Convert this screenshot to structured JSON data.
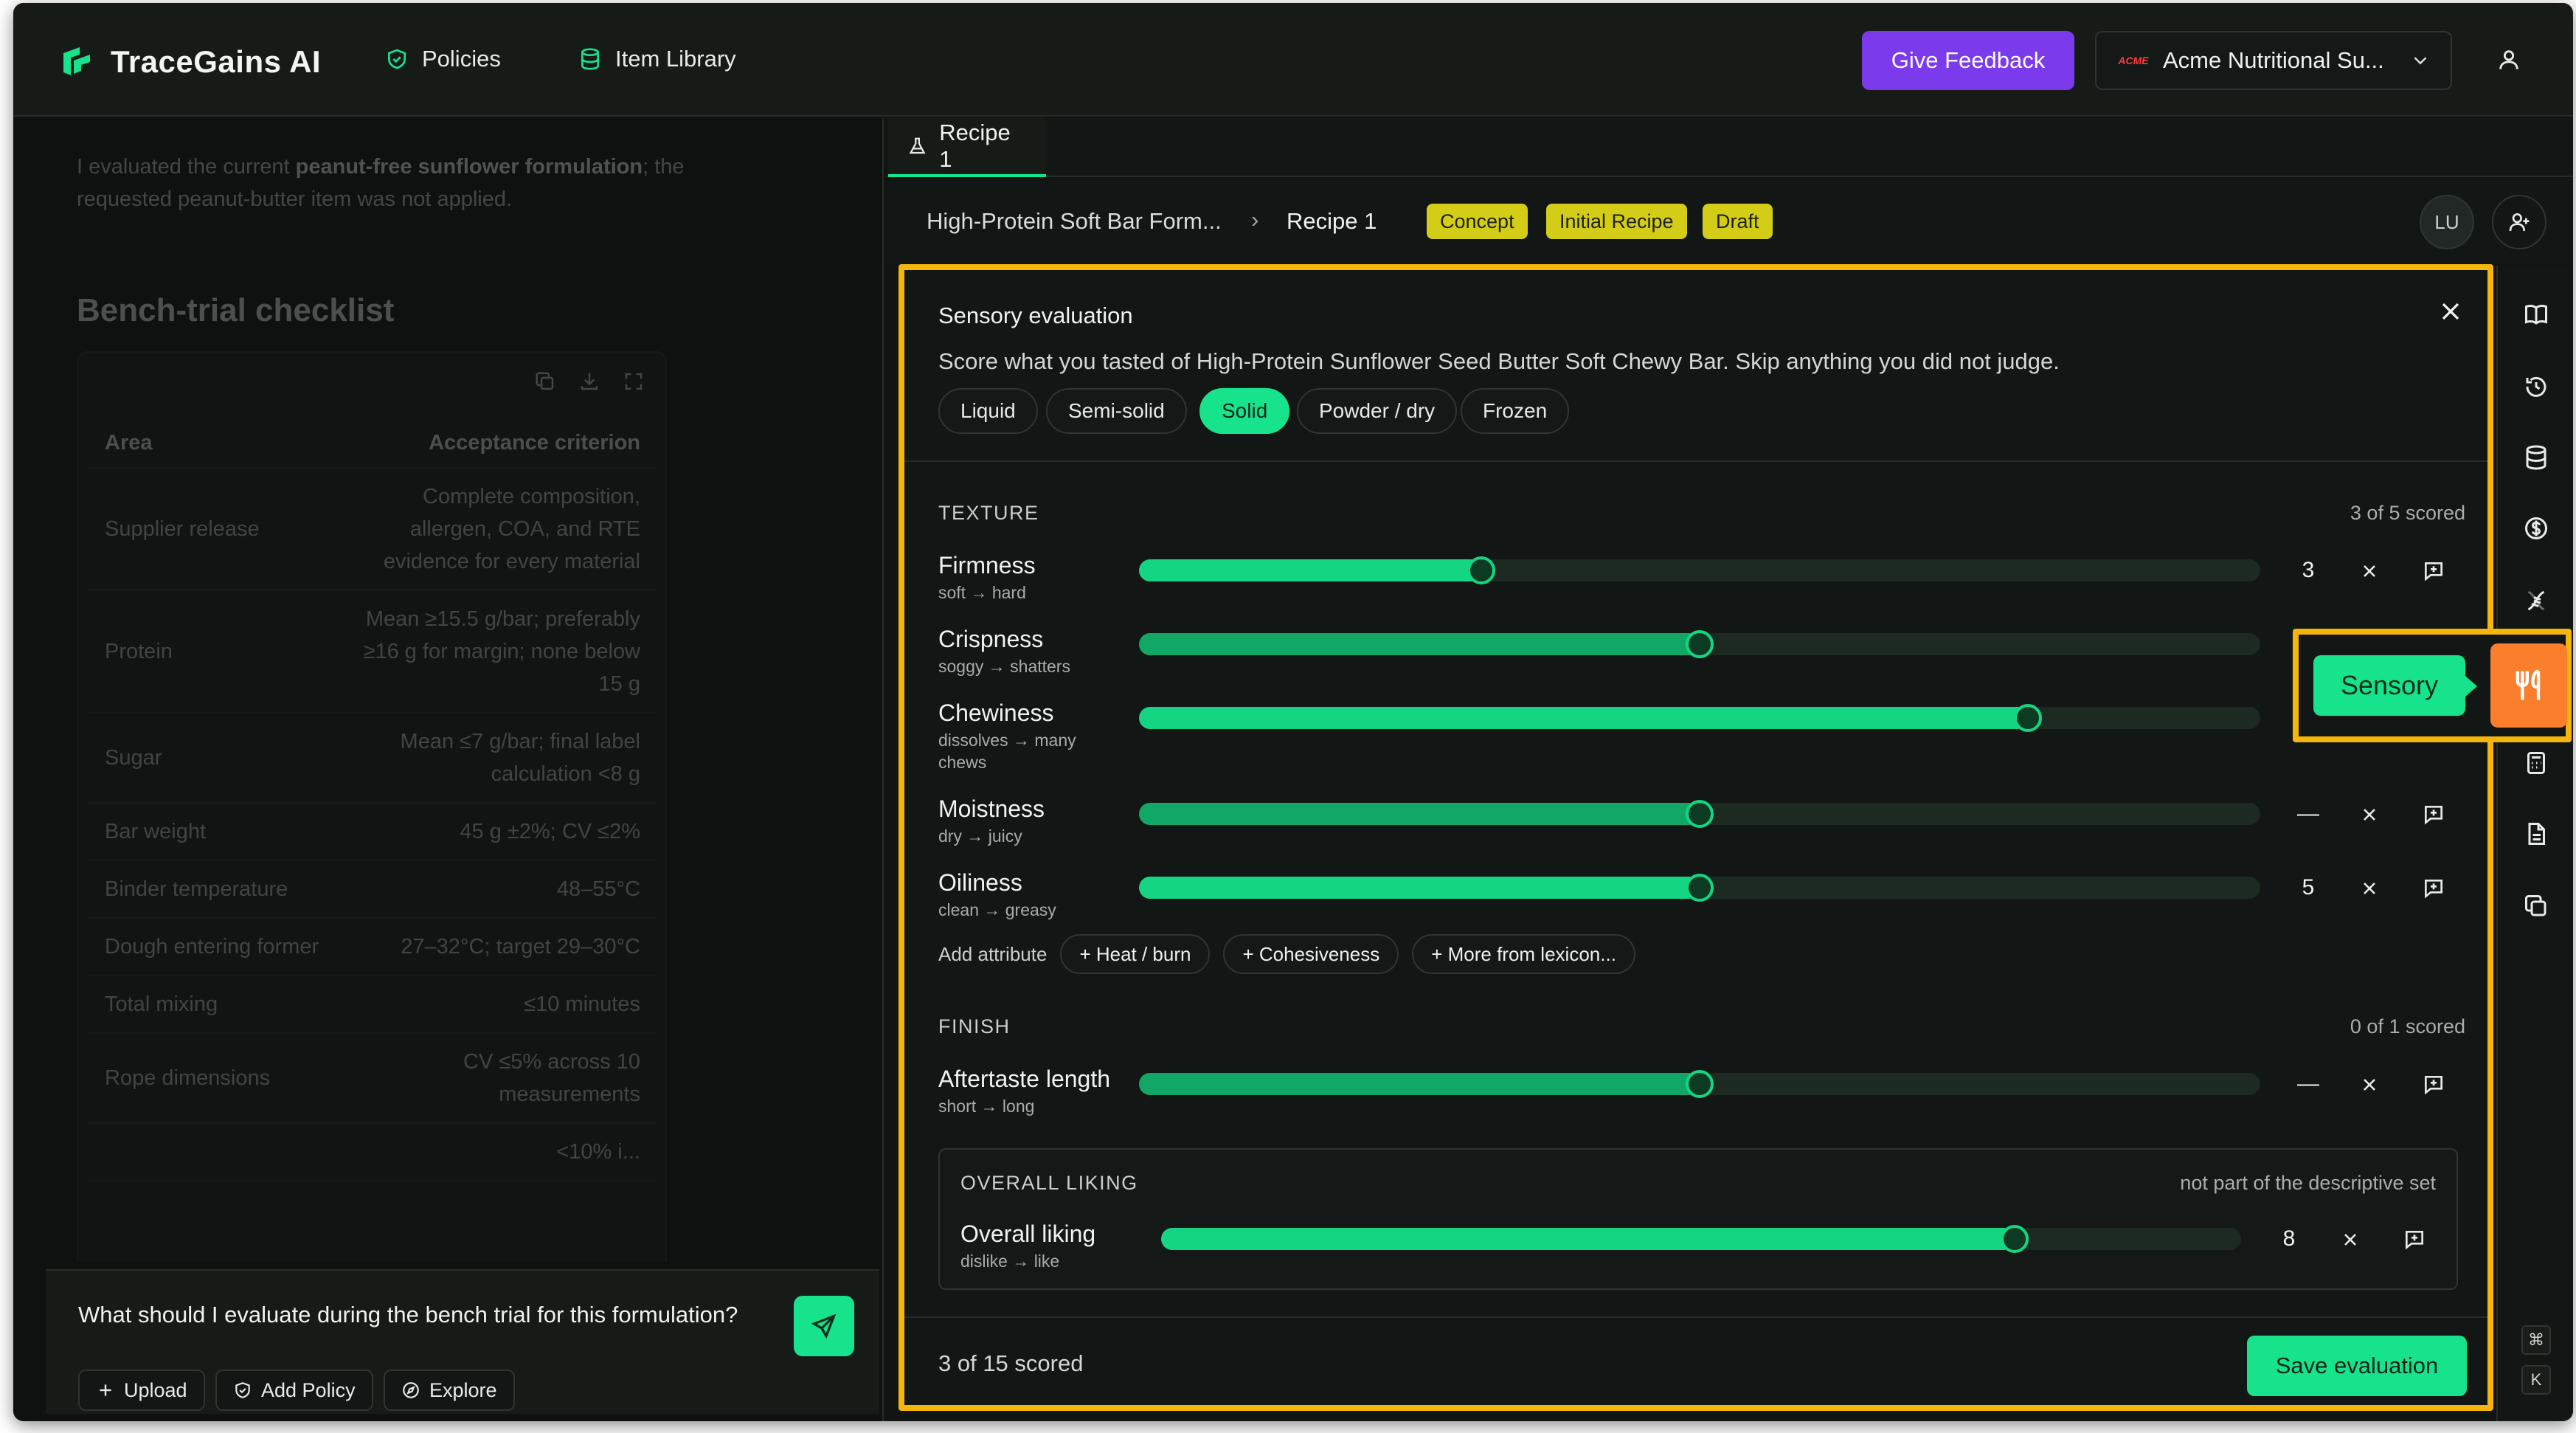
{
  "app": {
    "name": "TraceGains AI"
  },
  "nav": {
    "policies": "Policies",
    "item_library": "Item Library"
  },
  "header": {
    "feedback": "Give Feedback",
    "org_logo_text": "ACME",
    "org_name": "Acme Nutritional Su..."
  },
  "chat": {
    "para_prefix": "I evaluated the current ",
    "para_bold": "peanut-free sunflower formulation",
    "para_suffix": "; the requested peanut-butter item was not applied.",
    "heading": "Bench-trial checklist",
    "table": {
      "col_area": "Area",
      "col_criterion": "Acceptance criterion",
      "rows": [
        {
          "area": "Supplier release",
          "criterion": "Complete composition, allergen, COA, and RTE evidence for every material"
        },
        {
          "area": "Protein",
          "criterion": "Mean ≥15.5 g/bar; preferably ≥16 g for margin; none below 15 g"
        },
        {
          "area": "Sugar",
          "criterion": "Mean ≤7 g/bar; final label calculation <8 g"
        },
        {
          "area": "Bar weight",
          "criterion": "45 g ±2%; CV ≤2%"
        },
        {
          "area": "Binder temperature",
          "criterion": "48–55°C"
        },
        {
          "area": "Dough entering former",
          "criterion": "27–32°C; target 29–30°C"
        },
        {
          "area": "Total mixing",
          "criterion": "≤10 minutes"
        },
        {
          "area": "Rope dimensions",
          "criterion": "CV ≤5% across 10 measurements"
        },
        {
          "area": "",
          "criterion": "<10% i..."
        }
      ]
    },
    "composer_text": "What should I evaluate during the bench trial for this formulation?",
    "upload": "Upload",
    "add_policy": "Add Policy",
    "explore": "Explore"
  },
  "tabs": [
    {
      "label": "Recipe 1"
    }
  ],
  "breadcrumb": {
    "parent": "High-Protein Soft Bar Form...",
    "sep": "›",
    "current": "Recipe 1",
    "badges": [
      "Concept",
      "Initial Recipe",
      "Draft"
    ],
    "avatar": "LU"
  },
  "sensory": {
    "title": "Sensory evaluation",
    "subtitle": "Score what you tasted of High-Protein Sunflower Seed Butter Soft Chewy Bar. Skip anything you did not judge.",
    "states": [
      "Liquid",
      "Semi-solid",
      "Solid",
      "Powder / dry",
      "Frozen"
    ],
    "active_state": "Solid",
    "texture": {
      "label": "TEXTURE",
      "count": "3 of 5 scored",
      "attributes": [
        {
          "name": "Firmness",
          "range": "soft → hard",
          "fraction": 0.305,
          "value": "3",
          "scored": true
        },
        {
          "name": "Crispness",
          "range": "soggy → shatters",
          "fraction": 0.5,
          "value": "",
          "scored": true
        },
        {
          "name": "Chewiness",
          "range": "dissolves → many chews",
          "fraction": 0.793,
          "value": "",
          "scored": true
        },
        {
          "name": "Moistness",
          "range": "dry → juicy",
          "fraction": 0.5,
          "value": "—",
          "scored": false
        },
        {
          "name": "Oiliness",
          "range": "clean → greasy",
          "fraction": 0.5,
          "value": "5",
          "scored": true
        }
      ]
    },
    "add_attribute": "Add attribute",
    "add_chips": [
      "+ Heat / burn",
      "+ Cohesiveness",
      "+ More from lexicon..."
    ],
    "finish": {
      "label": "FINISH",
      "count": "0 of 1 scored",
      "attributes": [
        {
          "name": "Aftertaste length",
          "range": "short → long",
          "fraction": 0.5,
          "value": "—",
          "scored": false
        }
      ]
    },
    "liking": {
      "label": "OVERALL LIKING",
      "note": "not part of the descriptive set",
      "name": "Overall liking",
      "range": "dislike → like",
      "fraction": 0.79,
      "value": "8"
    },
    "footer_count": "3 of 15 scored",
    "save": "Save evaluation"
  },
  "tooltip": {
    "label": "Sensory"
  },
  "kbd": [
    "⌘",
    "K"
  ],
  "colors": {
    "accent": "#16e38b",
    "highlight": "#f5b50a",
    "feedback": "#7c3aed",
    "badge": "#d4cd18",
    "sensory_button": "#fb7e2c"
  }
}
